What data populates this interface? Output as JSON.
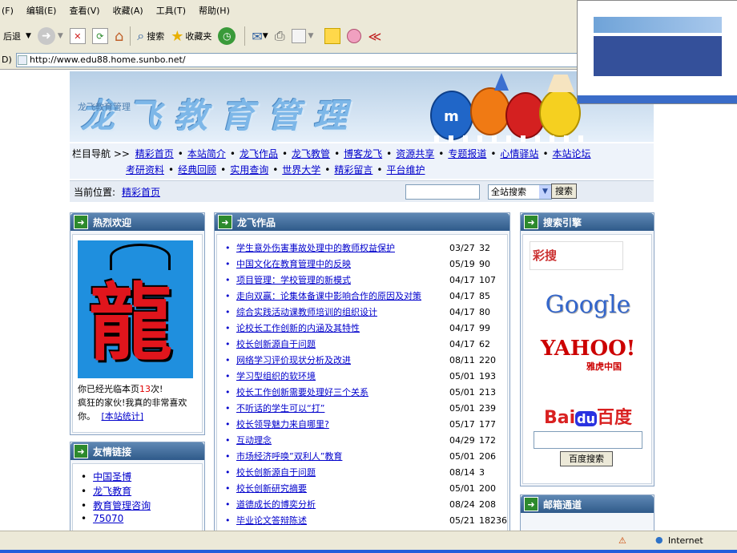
{
  "menu": [
    "(F)",
    "编辑(E)",
    "查看(V)",
    "收藏(A)",
    "工具(T)",
    "帮助(H)"
  ],
  "toolbar": {
    "back": "后退",
    "search": "搜索",
    "favorites": "收藏夹"
  },
  "address": {
    "prefix": "D)",
    "url": "http://www.edu88.home.sunbo.net/"
  },
  "banner": {
    "title": "龙飞教育管理",
    "small": "龙飞教育管理",
    "mm_letter": "m"
  },
  "nav": {
    "label": "栏目导航 >>",
    "row1": [
      "精彩首页",
      "本站简介",
      "龙飞作品",
      "龙飞教管",
      "博客龙飞",
      "资源共享",
      "专题报道",
      "心情驿站",
      "本站论坛"
    ],
    "row2": [
      "考研资料",
      "经典回顾",
      "实用查询",
      "世界大学",
      "精彩留言",
      "平台维护"
    ]
  },
  "location": {
    "label": "当前位置:",
    "link": "精彩首页",
    "scope": "全站搜索",
    "button": "搜索"
  },
  "welcome": {
    "title": "热烈欢迎",
    "img_char": "龍",
    "text_a": "你已经光临本页",
    "count": "13",
    "text_b": "次!",
    "text_c": "疯狂的家伙!我真的非常喜欢你。",
    "stats_link": "[本站统计]"
  },
  "friends": {
    "title": "友情链接",
    "items": [
      "中国圣博",
      "龙飞教育",
      "教育管理咨询",
      "75070"
    ]
  },
  "works": {
    "title": "龙飞作品",
    "items": [
      {
        "title": "学生意外伤害事故处理中的教师权益保护",
        "date": "03/27",
        "views": "32"
      },
      {
        "title": "中国文化在教育管理中的反映",
        "date": "05/19",
        "views": "90"
      },
      {
        "title": "项目管理：学校管理的新模式",
        "date": "04/17",
        "views": "107"
      },
      {
        "title": "走向双赢：论集体备课中影响合作的原因及对策",
        "date": "04/17",
        "views": "85"
      },
      {
        "title": "综合实践活动课教师培训的组织设计",
        "date": "04/17",
        "views": "80"
      },
      {
        "title": "论校长工作创新的内涵及其特性",
        "date": "04/17",
        "views": "99"
      },
      {
        "title": "校长创新源自于问题",
        "date": "04/17",
        "views": "62"
      },
      {
        "title": "网络学习评价现状分析及改进",
        "date": "08/11",
        "views": "220"
      },
      {
        "title": "学习型组织的软环境",
        "date": "05/01",
        "views": "193"
      },
      {
        "title": "校长工作创新需要处理好三个关系",
        "date": "05/01",
        "views": "213"
      },
      {
        "title": "不听话的学生可以“打”",
        "date": "05/01",
        "views": "239"
      },
      {
        "title": "校长领导魅力来自哪里?",
        "date": "05/17",
        "views": "177"
      },
      {
        "title": "互动理念",
        "date": "04/29",
        "views": "172"
      },
      {
        "title": "市场经济呼唤”双利人”教育",
        "date": "05/01",
        "views": "206"
      },
      {
        "title": "校长创新源自于问题",
        "date": "08/14",
        "views": "3"
      },
      {
        "title": "校长创新研究摘要",
        "date": "05/01",
        "views": "200"
      },
      {
        "title": "道德成长的博奕分析",
        "date": "08/24",
        "views": "208"
      },
      {
        "title": "毕业论文答辩陈述",
        "date": "05/21",
        "views": "18236"
      }
    ]
  },
  "engines": {
    "title": "搜索引擎",
    "caisou": "彩搜",
    "google": "Google",
    "yahoo": "YAHOO!",
    "yahoo_cn": "雅虎中国",
    "baidu_a": "Bai",
    "baidu_du": "du",
    "baidu_b": "百度",
    "baidu_button": "百度搜索"
  },
  "mail": {
    "title": "邮箱通道"
  },
  "status": {
    "zone": "Internet"
  },
  "colors": {
    "panel_header": "#3a6699",
    "link": "#0000cc",
    "google_blue": "#3366cc",
    "yahoo_red": "#cc0000",
    "baidu_red": "#d92121",
    "baidu_blue": "#2932e1"
  }
}
